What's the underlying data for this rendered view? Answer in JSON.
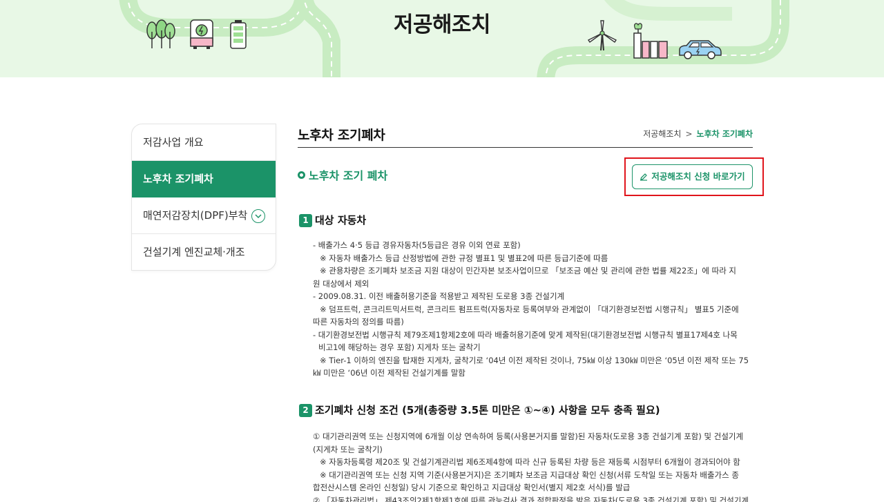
{
  "banner": {
    "title": "저공해조치"
  },
  "sidebar": {
    "items": [
      {
        "label": "저감사업 개요"
      },
      {
        "label": "노후차 조기폐차"
      },
      {
        "label": "매연저감장치(DPF)부착"
      },
      {
        "label": "건설기계 엔진교체·개조"
      }
    ]
  },
  "header": {
    "page_title": "노후차 조기폐차",
    "breadcrumb": {
      "parent": "저공해조치",
      "separator": ">",
      "current": "노후차 조기폐차"
    }
  },
  "main": {
    "sub_heading": "노후차 조기 폐차",
    "apply_button": "저공해조치 신청 바로가기",
    "section1": {
      "number": "1",
      "title": "대상 자동차",
      "lines": [
        "- 배출가스 4·5 등급 경유자동차(5등급은 경유 이외 연료 포함)",
        "※ 자동차 배출가스 등급 산정방법에 관한 규정 별표1 및 별표2에 따른 등급기준에 따름",
        "※ 관용차량은 조기폐차 보조금 지원 대상이 민간자본 보조사업이므로 「보조금 예산 및 관리에 관한 법률 제22조」에 따라 지",
        "원 대상에서 제외",
        "- 2009.08.31. 이전 배출허용기준을 적용받고 제작된 도로용 3종 건설기계",
        "※ 덤프트럭, 콘크리트믹서트럭, 콘크리트 펌프트럭(자동차로 등록여부와 관계없이 「대기환경보전법 시행규칙」 별표5 기준에",
        "따른 자동차의 정의를 따름)",
        "- 대기환경보전법 시행규칙 제79조제1항제2호에 따라 배출허용기준에 맞게 제작된(대기환경보전법 시행규칙 별표17제4호 나목",
        "비고1에 해당하는 경우 포함) 지게차 또는 굴착기",
        "※ Tier-1 이하의 엔진을 탑재한 지게차, 굴착기로 ‘04년 이전 제작된 것이나, 75㎾ 이상 130㎾ 미만은 ‘05년 이전 제작 또는 75",
        "㎾ 미만은 ‘06년 이전 제작된 건설기계를 말함"
      ]
    },
    "section2": {
      "number": "2",
      "title": "조기폐차 신청 조건 (5개(총중량 3.5톤 미만은 ①~④) 사항을 모두 충족 필요)",
      "lines": [
        "① 대기관리권역 또는 신청지역에 6개월 이상 연속하여 등록(사용본거지를 말함)된 자동차(도로용 3종 건설기계 포함) 및 건설기계",
        "(지게차 또는 굴착기)",
        "※ 자동차등록령 제20조 및 건설기계관리법 제6조제4항에 따라 신규 등록된 차량 등은 재등록 시점부터 6개월이 경과되어야 함",
        "※ 대기관리권역 또는 신청 지역 기준(사용본거지)은 조기폐차 보조금 지급대상 확인 신청(서류 도착일 또는 자동차 배출가스 종",
        "합전산시스템 온라인 신청일) 당시 기준으로 확인하고 지급대상 확인서(별지 제2호 서식)를 발급",
        "② 「자동차관리법」 제43조의2제1항제1호에 따른 관능검사 결과 적합판정을 받은 자동차(도로용 3종 건설기계 포함) 및 건설기계"
      ]
    }
  },
  "colors": {
    "accent": "#1b9368",
    "highlight": "#e0141b",
    "banner_bg": "#e8f8e6"
  }
}
